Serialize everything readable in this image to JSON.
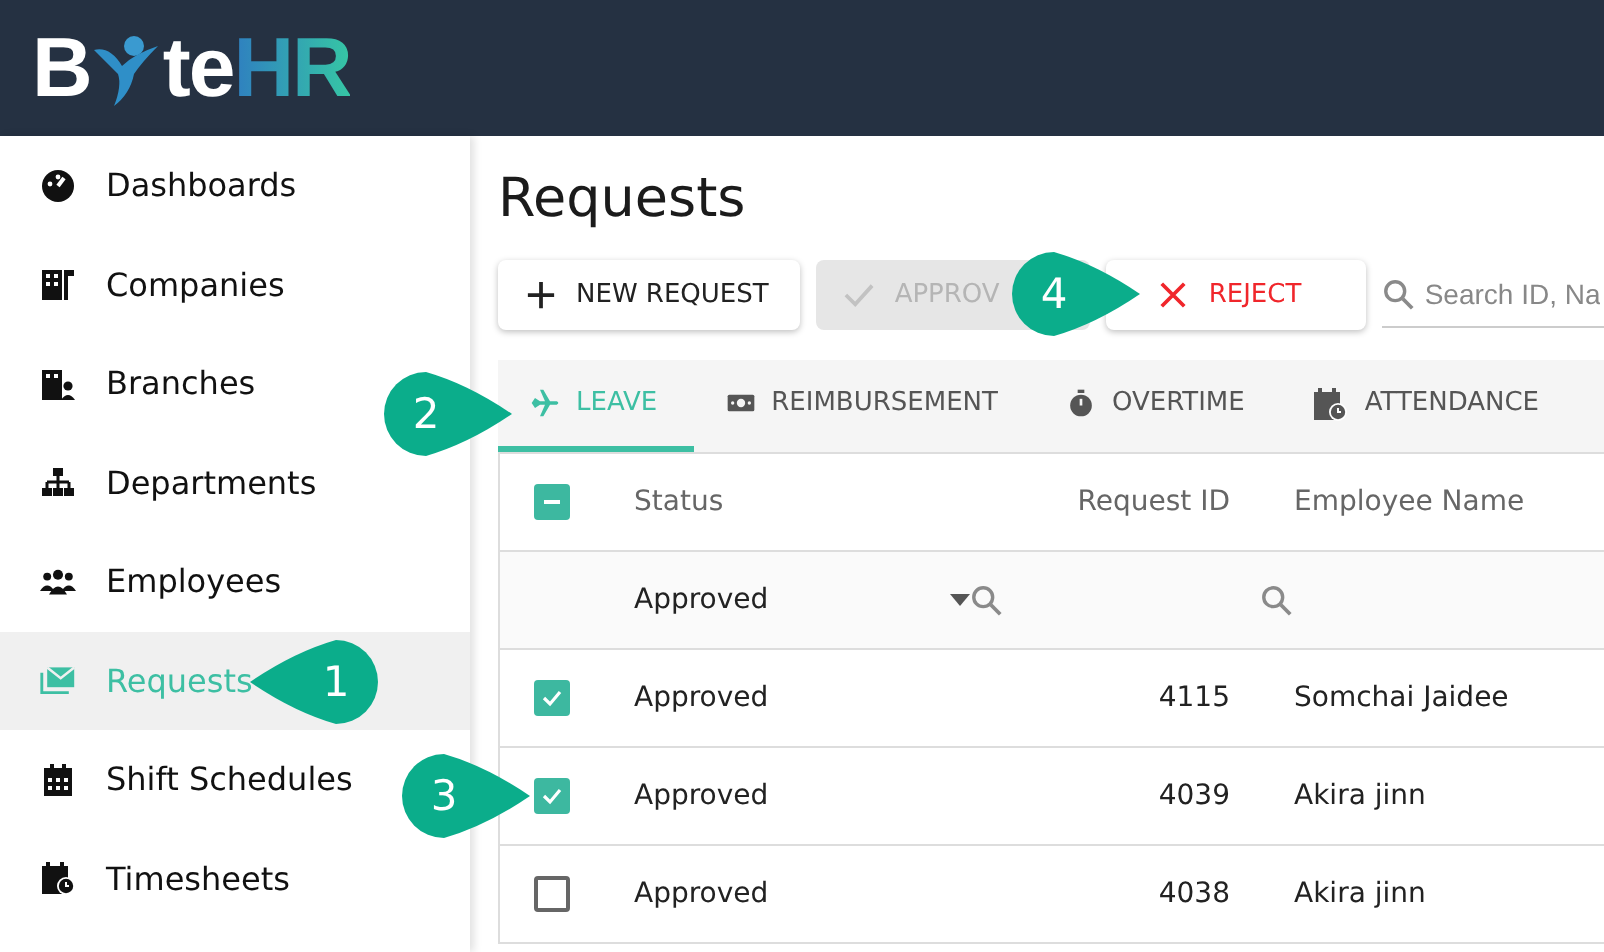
{
  "logo": {
    "lead": "B",
    "middle": "te",
    "accent": "HR"
  },
  "sidebar": {
    "items": [
      {
        "label": "Dashboards",
        "selected": false
      },
      {
        "label": "Companies",
        "selected": false
      },
      {
        "label": "Branches",
        "selected": false
      },
      {
        "label": "Departments",
        "selected": false
      },
      {
        "label": "Employees",
        "selected": false
      },
      {
        "label": "Requests",
        "selected": true
      },
      {
        "label": "Shift Schedules",
        "selected": false
      },
      {
        "label": "Timesheets",
        "selected": false
      }
    ]
  },
  "page_title": "Requests",
  "toolbar": {
    "buttons": [
      {
        "label": "NEW REQUEST",
        "kind": "plus",
        "disabled": false
      },
      {
        "label": "APPROV",
        "kind": "check",
        "disabled": true
      },
      {
        "label": "REJECT",
        "kind": "cross",
        "disabled": false
      }
    ],
    "search": {
      "placeholder": "Search ID, Na"
    }
  },
  "tabs": [
    {
      "label": "LEAVE",
      "selected": true
    },
    {
      "label": "REIMBURSEMENT",
      "selected": false
    },
    {
      "label": "OVERTIME",
      "selected": false
    },
    {
      "label": "ATTENDANCE",
      "selected": false
    }
  ],
  "table": {
    "select_all_partial": true,
    "columns": [
      "Status",
      "Request ID",
      "Employee Name"
    ],
    "filter": {
      "status": "Approved"
    },
    "rows": [
      {
        "checked": true,
        "status": "Approved",
        "request_id": "4115",
        "employee": "Somchai Jaidee"
      },
      {
        "checked": true,
        "status": "Approved",
        "request_id": "4039",
        "employee": "Akira jinn"
      },
      {
        "checked": false,
        "status": "Approved",
        "request_id": "4038",
        "employee": "Akira jinn"
      }
    ]
  },
  "callouts": [
    {
      "label": "1"
    },
    {
      "label": "2"
    },
    {
      "label": "3"
    },
    {
      "label": "4"
    }
  ]
}
